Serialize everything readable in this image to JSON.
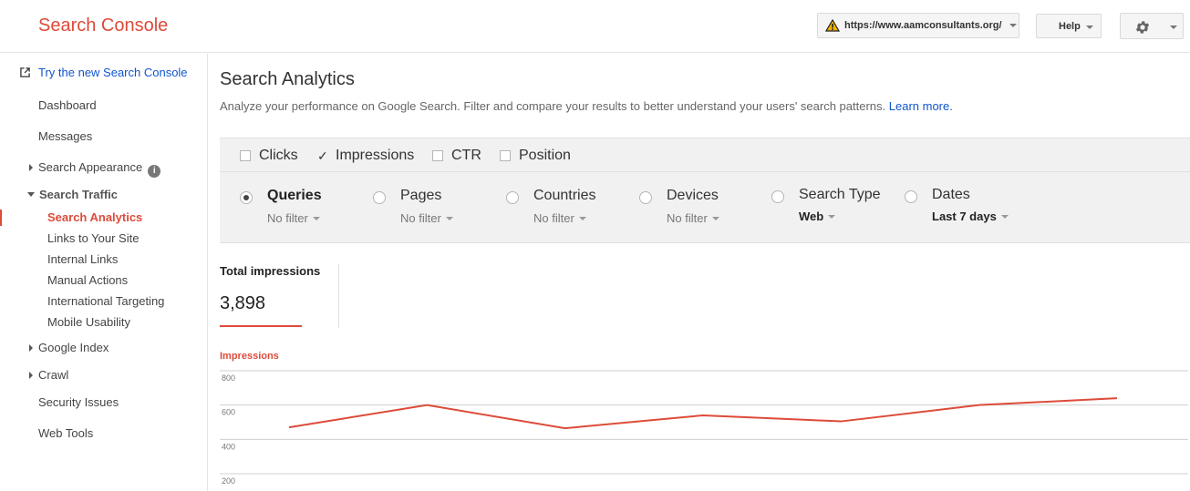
{
  "header": {
    "brand": "Search Console",
    "site_url": "https://www.aamconsultants.org/",
    "help_label": "Help"
  },
  "sidebar": {
    "new_console_link": "Try the new Search Console",
    "items": [
      {
        "label": "Dashboard"
      },
      {
        "label": "Messages"
      },
      {
        "label": "Search Appearance"
      },
      {
        "label": "Search Traffic"
      },
      {
        "label": "Search Analytics"
      },
      {
        "label": "Links to Your Site"
      },
      {
        "label": "Internal Links"
      },
      {
        "label": "Manual Actions"
      },
      {
        "label": "International Targeting"
      },
      {
        "label": "Mobile Usability"
      },
      {
        "label": "Google Index"
      },
      {
        "label": "Crawl"
      },
      {
        "label": "Security Issues"
      },
      {
        "label": "Web Tools"
      }
    ],
    "info_glyph": "i"
  },
  "main": {
    "title": "Search Analytics",
    "description": "Analyze your performance on Google Search. Filter and compare your results to better understand your users' search patterns.",
    "learn_more": "Learn more.",
    "metrics": [
      {
        "label": "Clicks",
        "checked": false
      },
      {
        "label": "Impressions",
        "checked": true
      },
      {
        "label": "CTR",
        "checked": false
      },
      {
        "label": "Position",
        "checked": false
      }
    ],
    "dimensions": [
      {
        "label": "Queries",
        "filter": "No filter",
        "selected": true
      },
      {
        "label": "Pages",
        "filter": "No filter",
        "selected": false
      },
      {
        "label": "Countries",
        "filter": "No filter",
        "selected": false
      },
      {
        "label": "Devices",
        "filter": "No filter",
        "selected": false
      },
      {
        "label": "Search Type",
        "filter": "Web",
        "selected": false
      },
      {
        "label": "Dates",
        "filter": "Last 7 days",
        "selected": false
      }
    ],
    "total_label": "Total impressions",
    "total_value": "3,898"
  },
  "chart_data": {
    "type": "line",
    "title": "Impressions",
    "series": [
      {
        "name": "Impressions",
        "values": [
          470,
          600,
          465,
          540,
          505,
          600,
          640
        ],
        "color": "#dd4b39"
      }
    ],
    "yticks": [
      800,
      600,
      400,
      200
    ],
    "ylim": [
      200,
      800
    ],
    "grid": true
  },
  "colors": {
    "accent": "#dd4b39",
    "link": "#1155cc"
  }
}
